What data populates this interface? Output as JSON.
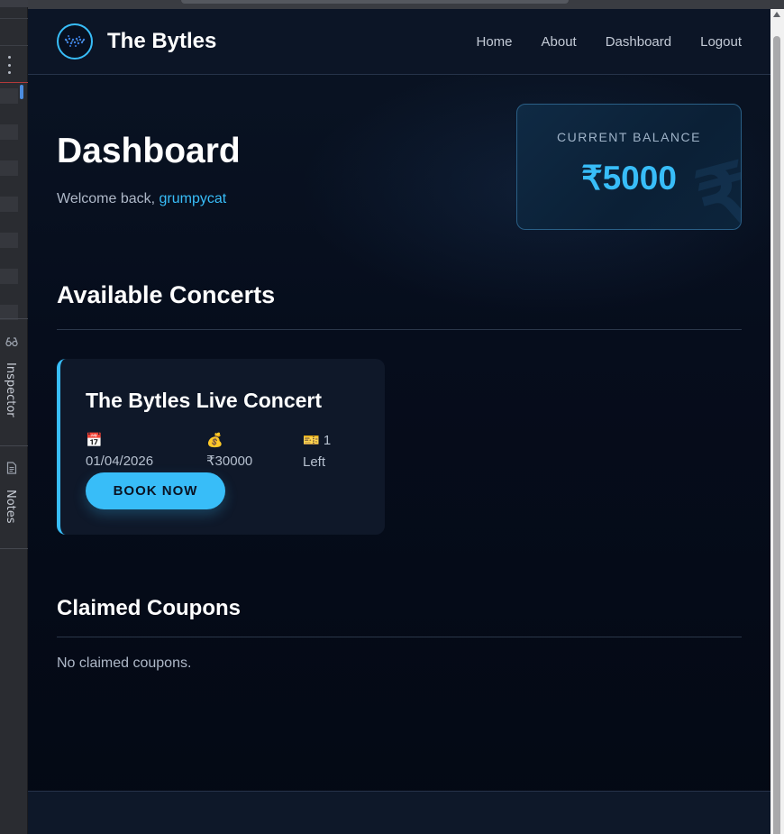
{
  "app": {
    "brand": "The Bytles"
  },
  "nav": {
    "items": [
      "Home",
      "About",
      "Dashboard",
      "Logout"
    ]
  },
  "dashboard": {
    "title": "Dashboard",
    "welcome_prefix": "Welcome back, ",
    "username": "grumpycat"
  },
  "balance": {
    "label": "CURRENT BALANCE",
    "value": "₹5000"
  },
  "concerts": {
    "heading": "Available Concerts",
    "items": [
      {
        "title": "The Bytles Live Concert",
        "date_icon": "📅",
        "date": "01/04/2026",
        "price_icon": "💰",
        "price": "₹30000",
        "tickets_icon": "🎫",
        "tickets": "1",
        "tickets_suffix": "Left",
        "button": "BOOK NOW"
      }
    ]
  },
  "coupons": {
    "heading": "Claimed Coupons",
    "empty": "No claimed coupons."
  },
  "devtools": {
    "inspector": "Inspector",
    "notes": "Notes"
  },
  "colors": {
    "accent": "#38bdf8",
    "background": "#060d1c",
    "card": "#0f1829"
  },
  "icons": {
    "logo": "bytles-logo-icon",
    "inspector": "glasses-icon",
    "notes": "document-icon",
    "menu": "kebab-menu-icon"
  }
}
